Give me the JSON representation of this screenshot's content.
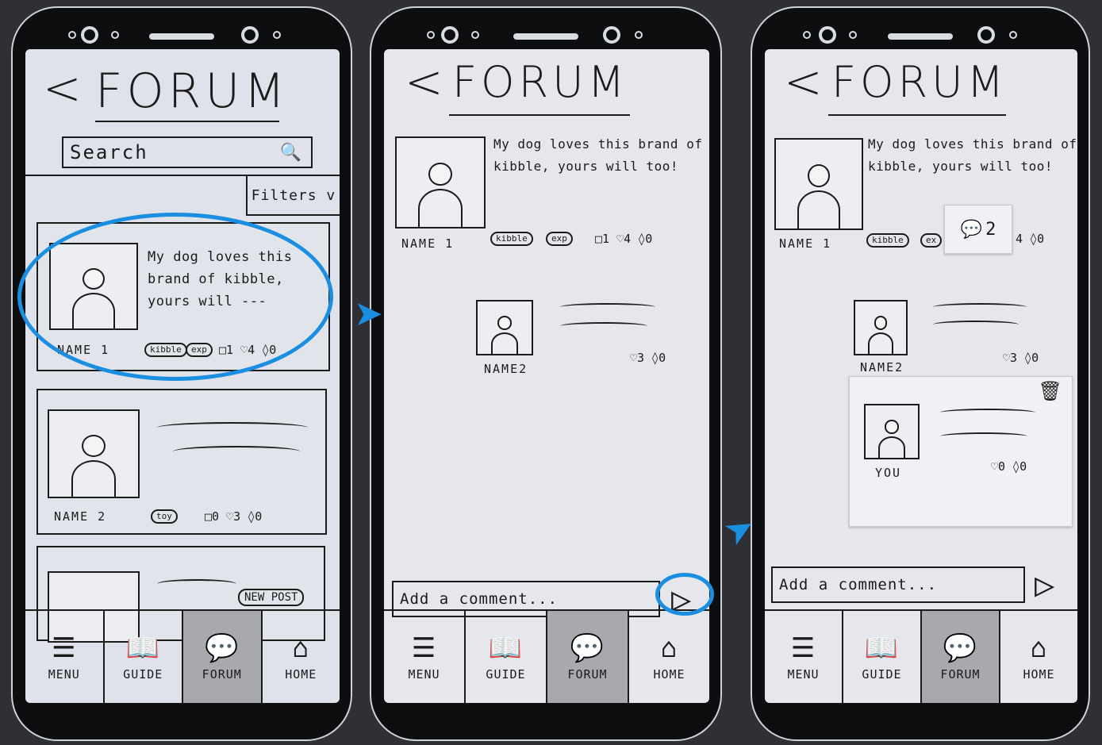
{
  "screens": [
    {
      "title": "FORUM",
      "back_glyph": "<",
      "search": {
        "label": "Search"
      },
      "filters_label": "Filters v",
      "posts": [
        {
          "name": "NAME 1",
          "text": "My dog loves this brand of kibble, yours will ---",
          "tags": [
            "kibble",
            "exp"
          ],
          "stats": "□1 ♡4 ◊0"
        },
        {
          "name": "NAME 2",
          "text": "",
          "tags": [
            "toy"
          ],
          "stats": "□0 ♡3 ◊0"
        }
      ],
      "new_post_label": "NEW POST"
    },
    {
      "title": "FORUM",
      "back_glyph": "<",
      "post": {
        "name": "NAME 1",
        "text": "My dog loves this brand of kibble, yours will too!",
        "tags": [
          "kibble",
          "exp"
        ],
        "stats": "□1 ♡4 ◊0"
      },
      "reply": {
        "name": "NAME2",
        "stats": "♡3 ◊0"
      },
      "comment_placeholder": "Add a comment..."
    },
    {
      "title": "FORUM",
      "back_glyph": "<",
      "post": {
        "name": "NAME 1",
        "text": "My dog loves this brand of kibble, yours will too!",
        "tags": [
          "kibble",
          "ex"
        ],
        "stats": "4 ◊0"
      },
      "comment_count_popup": "2",
      "reply": {
        "name": "NAME2",
        "stats": "♡3 ◊0"
      },
      "own_reply": {
        "name": "YOU",
        "stats": "♡0 ◊0"
      },
      "comment_placeholder": "Add a comment..."
    }
  ],
  "nav": {
    "menu": "MENU",
    "guide": "GUIDE",
    "forum": "FORUM",
    "home": "HOME"
  },
  "accent_color": "#1a8ee0"
}
